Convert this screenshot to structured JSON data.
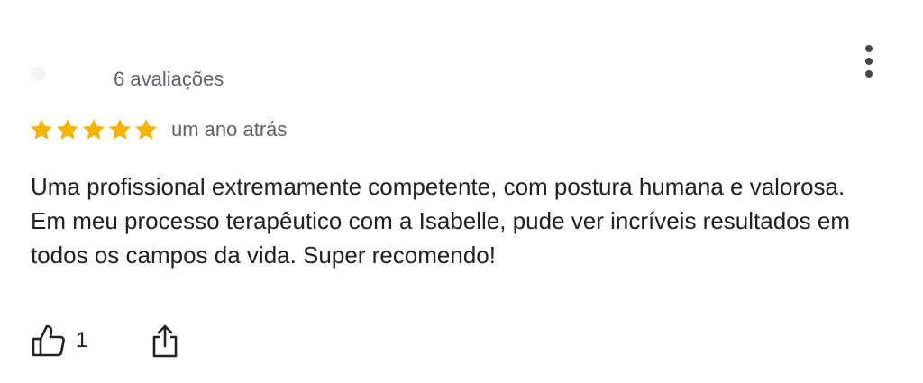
{
  "review": {
    "reviewer_review_count": "6 avaliações",
    "rating": 5,
    "rating_max": 5,
    "timestamp": "um ano atrás",
    "text": "Uma profissional extremamente competente, com postura humana e valorosa. Em meu processo terapêutico com a Isabelle, pude ver incríveis resultados em todos os campos da vida. Super recomendo!",
    "like_count": "1"
  },
  "icons": {
    "menu": "more-vert-icon",
    "star": "star-icon",
    "like": "thumb-up-icon",
    "share": "share-icon"
  },
  "colors": {
    "star": "#f4b400",
    "secondary_text": "#5f6368",
    "primary_text": "#202124"
  }
}
